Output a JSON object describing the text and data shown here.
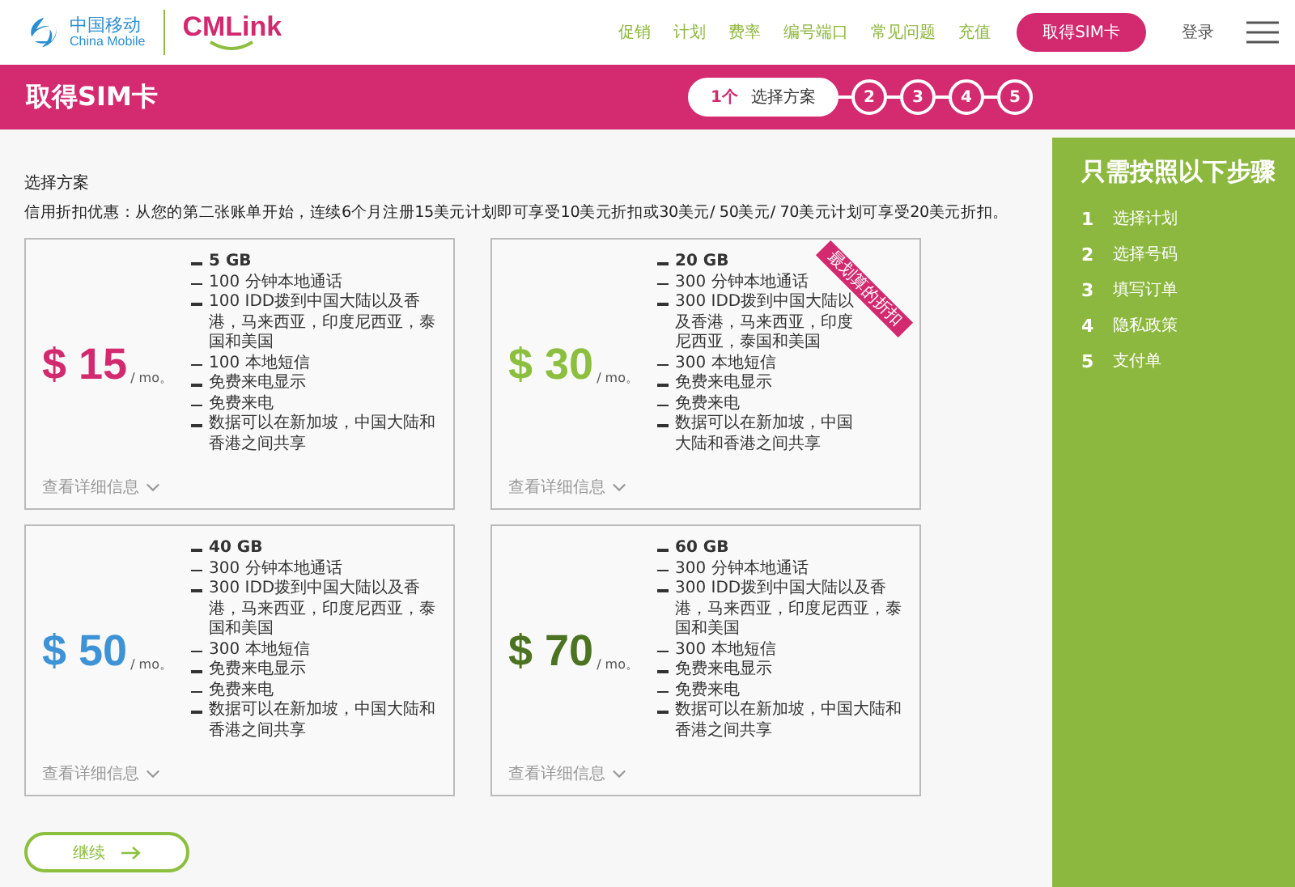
{
  "header": {
    "logo_cn": "中国移动",
    "logo_en": "China Mobile",
    "brand": "CMLink",
    "nav": [
      {
        "label": "促销"
      },
      {
        "label": "计划"
      },
      {
        "label": "费率"
      },
      {
        "label": "编号端口"
      },
      {
        "label": "常见问题"
      },
      {
        "label": "充值"
      }
    ],
    "cta": "取得SIM卡",
    "login": "登录"
  },
  "title_bar": {
    "title": "取得SIM卡",
    "steps": [
      {
        "label": "1个",
        "text": "选择方案",
        "selected": true
      },
      {
        "label": "2",
        "selected": false
      },
      {
        "label": "3",
        "selected": false
      },
      {
        "label": "4",
        "selected": false
      },
      {
        "label": "5",
        "selected": false
      }
    ]
  },
  "section_title": "选择方案",
  "promo": "信用折扣优惠：从您的第二张账单开始，连续6个月注册15美元计划即可享受10美元折扣或30美元/ 50美元/ 70美元计划可享受20美元折扣。",
  "plans": [
    {
      "price": "$ 15",
      "unit": "/ mo。",
      "color": "#d2296f",
      "features": [
        "5 GB",
        "100 分钟本地通话",
        "100 IDD拨到中国大陆以及香港，马来西亚，印度尼西亚，泰国和美国",
        "100 本地短信",
        "免费来电显示",
        "免费来电",
        "数据可以在新加坡，中国大陆和香港之间共享"
      ],
      "details": "查看详细信息"
    },
    {
      "price": "$ 30",
      "unit": "/ mo。",
      "color": "#8cbf3f",
      "badge": "最划算的折扣",
      "features": [
        "20 GB",
        "300 分钟本地通话",
        "300 IDD拨到中国大陆以及香港，马来西亚，印度尼西亚，泰国和美国",
        "300 本地短信",
        "免费来电显示",
        "免费来电",
        "数据可以在新加坡，中国大陆和香港之间共享"
      ],
      "details": "查看详细信息"
    },
    {
      "price": "$ 50",
      "unit": "/ mo。",
      "color": "#3d93d6",
      "features": [
        "40 GB",
        "300 分钟本地通话",
        "300 IDD拨到中国大陆以及香港，马来西亚，印度尼西亚，泰国和美国",
        "300 本地短信",
        "免费来电显示",
        "免费来电",
        "数据可以在新加坡，中国大陆和香港之间共享"
      ],
      "details": "查看详细信息"
    },
    {
      "price": "$ 70",
      "unit": "/ mo。",
      "color": "#4c7322",
      "features": [
        "60 GB",
        "300 分钟本地通话",
        "300 IDD拨到中国大陆以及香港，马来西亚，印度尼西亚，泰国和美国",
        "300 本地短信",
        "免费来电显示",
        "免费来电",
        "数据可以在新加坡，中国大陆和香港之间共享"
      ],
      "details": "查看详细信息"
    }
  ],
  "continue_button": "继续",
  "sidebar": {
    "title": "只需按照以下步骤",
    "steps": [
      {
        "number": "1",
        "text": "选择计划"
      },
      {
        "number": "2",
        "text": "选择号码"
      },
      {
        "number": "3",
        "text": "填写订单"
      },
      {
        "number": "4",
        "text": "隐私政策"
      },
      {
        "number": "5",
        "text": "支付单"
      }
    ]
  }
}
